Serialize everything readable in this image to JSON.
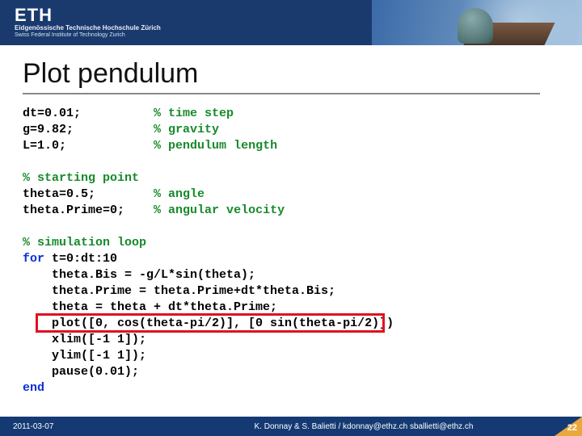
{
  "header": {
    "logo": "ETH",
    "sub1": "Eidgenössische Technische Hochschule Zürich",
    "sub2": "Swiss Federal Institute of Technology Zurich"
  },
  "title": "Plot pendulum",
  "code": {
    "l1a": "dt=0.01;",
    "l1b": "% time step",
    "l2a": "g=9.82;",
    "l2b": "% gravity",
    "l3a": "L=1.0;",
    "l3b": "% pendulum length",
    "l4": "% starting point",
    "l5a": "theta=0.5;",
    "l5b": "% angle",
    "l6a": "theta.Prime=0;",
    "l6b": "% angular velocity",
    "l7": "% simulation loop",
    "l8kw": "for ",
    "l8": "t=0:dt:10",
    "l9": "    theta.Bis = -g/L*sin(theta);",
    "l10": "    theta.Prime = theta.Prime+dt*theta.Bis;",
    "l11": "    theta = theta + dt*theta.Prime;",
    "l12": "    plot([0, cos(theta-pi/2)], [0 sin(theta-pi/2)])",
    "l13": "    xlim([-1 1]);",
    "l14": "    ylim([-1 1]);",
    "l15": "    pause(0.01);",
    "l16": "end"
  },
  "footer": {
    "date": "2011-03-07",
    "center": "K. Donnay & S. Balietti / kdonnay@ethz.ch   sballietti@ethz.ch",
    "page": "22"
  }
}
